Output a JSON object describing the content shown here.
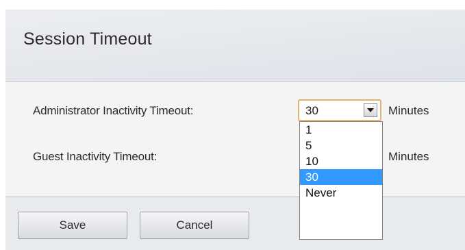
{
  "page": {
    "title": "Session Timeout"
  },
  "form": {
    "admin_label": "Administrator Inactivity Timeout:",
    "admin_value": "30",
    "admin_unit": "Minutes",
    "guest_label": "Guest Inactivity Timeout:",
    "guest_unit": "Minutes"
  },
  "dropdown": {
    "options": [
      "1",
      "5",
      "10",
      "30",
      "Never"
    ],
    "highlighted": "30",
    "arrow_icon": "chevron-down-icon"
  },
  "buttons": {
    "save_label": "Save",
    "cancel_label": "Cancel"
  },
  "colors": {
    "highlight": "#3399ff",
    "focus_border": "#e2b46a"
  }
}
